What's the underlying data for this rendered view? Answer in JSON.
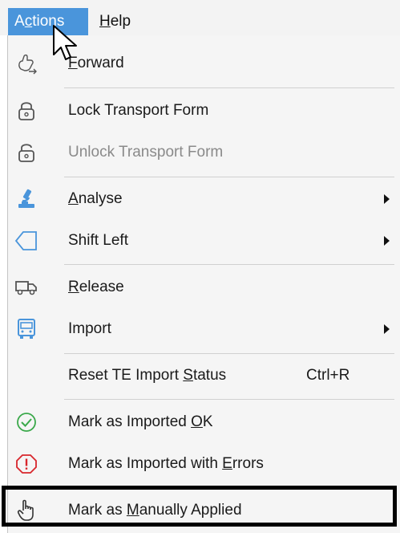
{
  "menubar": {
    "actions": {
      "pre": "A",
      "ul": "c",
      "post": "tions"
    },
    "help": {
      "pre": "",
      "ul": "H",
      "post": "elp"
    }
  },
  "menu": {
    "items": [
      {
        "pre": "",
        "ul": "F",
        "post": "orward",
        "icon": "forward-hand-icon",
        "enabled": true
      },
      {
        "pre": "Lock Transport Form",
        "ul": "",
        "post": "",
        "icon": "lock-icon",
        "enabled": true
      },
      {
        "pre": "Unlock Transport Form",
        "ul": "",
        "post": "",
        "icon": "unlock-icon",
        "enabled": false
      },
      {
        "pre": "",
        "ul": "A",
        "post": "nalyse",
        "icon": "microscope-icon",
        "enabled": true,
        "submenu": true
      },
      {
        "pre": "Shift Left",
        "ul": "",
        "post": "",
        "icon": "tag-left-icon",
        "enabled": true,
        "submenu": true
      },
      {
        "pre": "",
        "ul": "R",
        "post": "elease",
        "icon": "truck-icon",
        "enabled": true
      },
      {
        "pre": "Import",
        "ul": "",
        "post": "",
        "icon": "import-bus-icon",
        "enabled": true,
        "submenu": true
      },
      {
        "pre": "Reset TE Import ",
        "ul": "S",
        "post": "tatus",
        "shortcut": "Ctrl+R",
        "icon": "",
        "enabled": true
      },
      {
        "pre": "Mark as Imported ",
        "ul": "O",
        "post": "K",
        "icon": "check-circle-icon",
        "enabled": true
      },
      {
        "pre": "Mark as Imported with ",
        "ul": "E",
        "post": "rrors",
        "icon": "error-octagon-icon",
        "enabled": true
      },
      {
        "pre": "Mark as ",
        "ul": "M",
        "post": "anually Applied",
        "icon": "hand-pointer-icon",
        "enabled": true
      }
    ]
  },
  "colors": {
    "menubar_active": "#4a95db",
    "check_green": "#3aa84a",
    "error_red": "#d8262c",
    "icon_blue": "#4a95db",
    "disabled_text": "#8a8a8a"
  }
}
